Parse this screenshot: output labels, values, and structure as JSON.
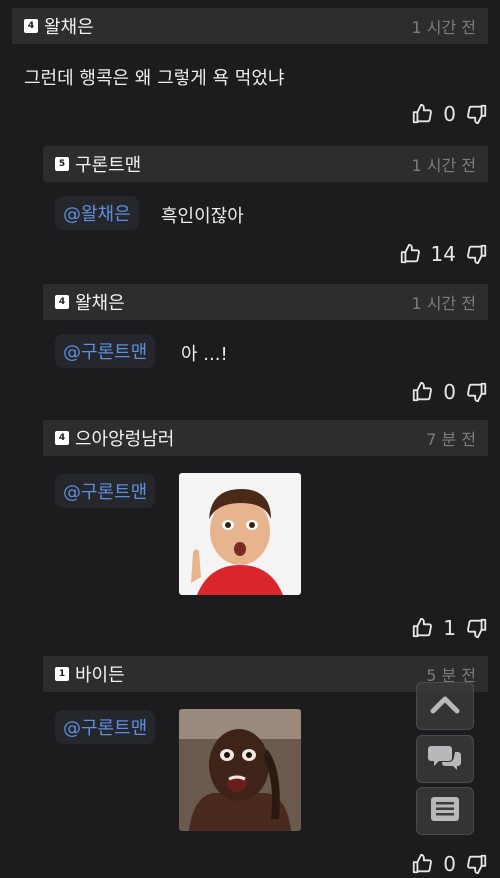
{
  "comments": [
    {
      "level": "4",
      "nickname": "왈채은",
      "time": "1 시간 전",
      "text": "그런데 행콕은 왜 그렇게 욕 먹었냐",
      "likes": "0"
    },
    {
      "level": "5",
      "nickname": "구론트맨",
      "time": "1 시간 전",
      "mention": "@왈채은",
      "text": "흑인이잖아",
      "likes": "14"
    },
    {
      "level": "4",
      "nickname": "왈채은",
      "time": "1 시간 전",
      "mention": "@구론트맨",
      "text": "아 ...!",
      "likes": "0"
    },
    {
      "level": "4",
      "nickname": "으아앙렁남러",
      "time": "7 분 전",
      "mention": "@구론트맨",
      "likes": "1"
    },
    {
      "level": "1",
      "nickname": "바이든",
      "time": "5 분 전",
      "mention": "@구론트맨",
      "likes": "0"
    }
  ],
  "icons": {
    "like": "thumbs-up-icon",
    "dislike": "thumbs-down-icon",
    "scroll_top": "chevron-up-icon",
    "chat": "chat-bubbles-icon",
    "list": "list-icon"
  },
  "colors": {
    "background": "#1c1c1e",
    "header": "#2d2d2f",
    "mention": "#5d8fdb"
  }
}
